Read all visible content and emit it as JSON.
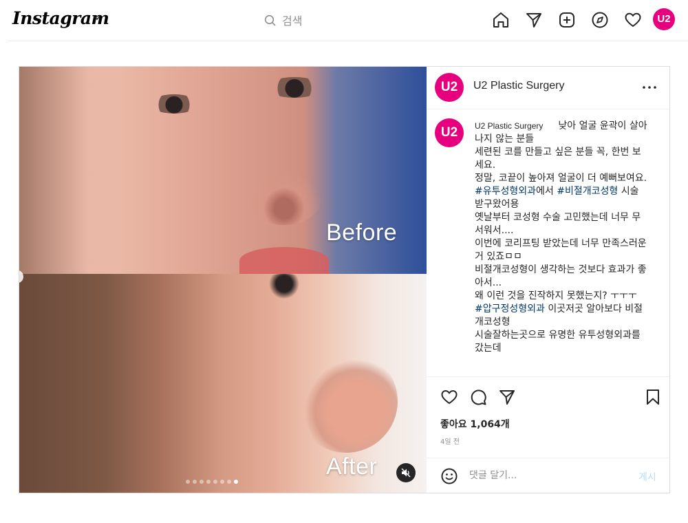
{
  "app": {
    "logo_text": "Instagram",
    "search_placeholder": "검색",
    "profile_avatar_text": "U2"
  },
  "nav_icons": [
    "home-icon",
    "direct-message-icon",
    "new-post-icon",
    "explore-icon",
    "activity-heart-icon",
    "profile-avatar"
  ],
  "colors": {
    "brand_magenta": "#e6007e",
    "hashtag_blue": "#00376b",
    "post_button_disabled": "#b2dffc",
    "muted_text": "#8e8e8e"
  },
  "media": {
    "label_before": "Before",
    "label_after": "After",
    "slide_count": 8,
    "active_slide": 8
  },
  "post": {
    "account_name": "U2 Plastic Surgery",
    "avatar_text": "U2",
    "caption_user": "U2 Plastic Surgery",
    "caption_first": "낮아 얼굴 윤곽이 살아나지 않는 분들",
    "caption_lines": [
      "세련된 코를 만들고 싶은 분들 꼭, 한번 보세요.",
      "정말, 코끝이 높아져 얼굴이 더 예뻐보여요.",
      "#유투성형외과에서 #비절개코성형 시술 받구왔어용",
      "옛날부터 코성형 수술 고민했는데 너무 무서워서....",
      "이번에 코리프팅 받았는데 너무 만족스러운거 있죠ㅁㅁ",
      "비절개코성형이 생각하는 것보다 효과가 좋아서...",
      "왜 이런 것을 진작하지 못했는지? ㅜㅜㅜ",
      "#압구정성형외과 이곳저곳 알아보다 비절개코성형",
      "시술잘하는곳으로 유명한 유투성형외과를 갔는데"
    ],
    "likes_text": "좋아요 1,064개",
    "date_text": "4일 전",
    "comment_placeholder": "댓글 달기...",
    "post_button": "게시"
  }
}
